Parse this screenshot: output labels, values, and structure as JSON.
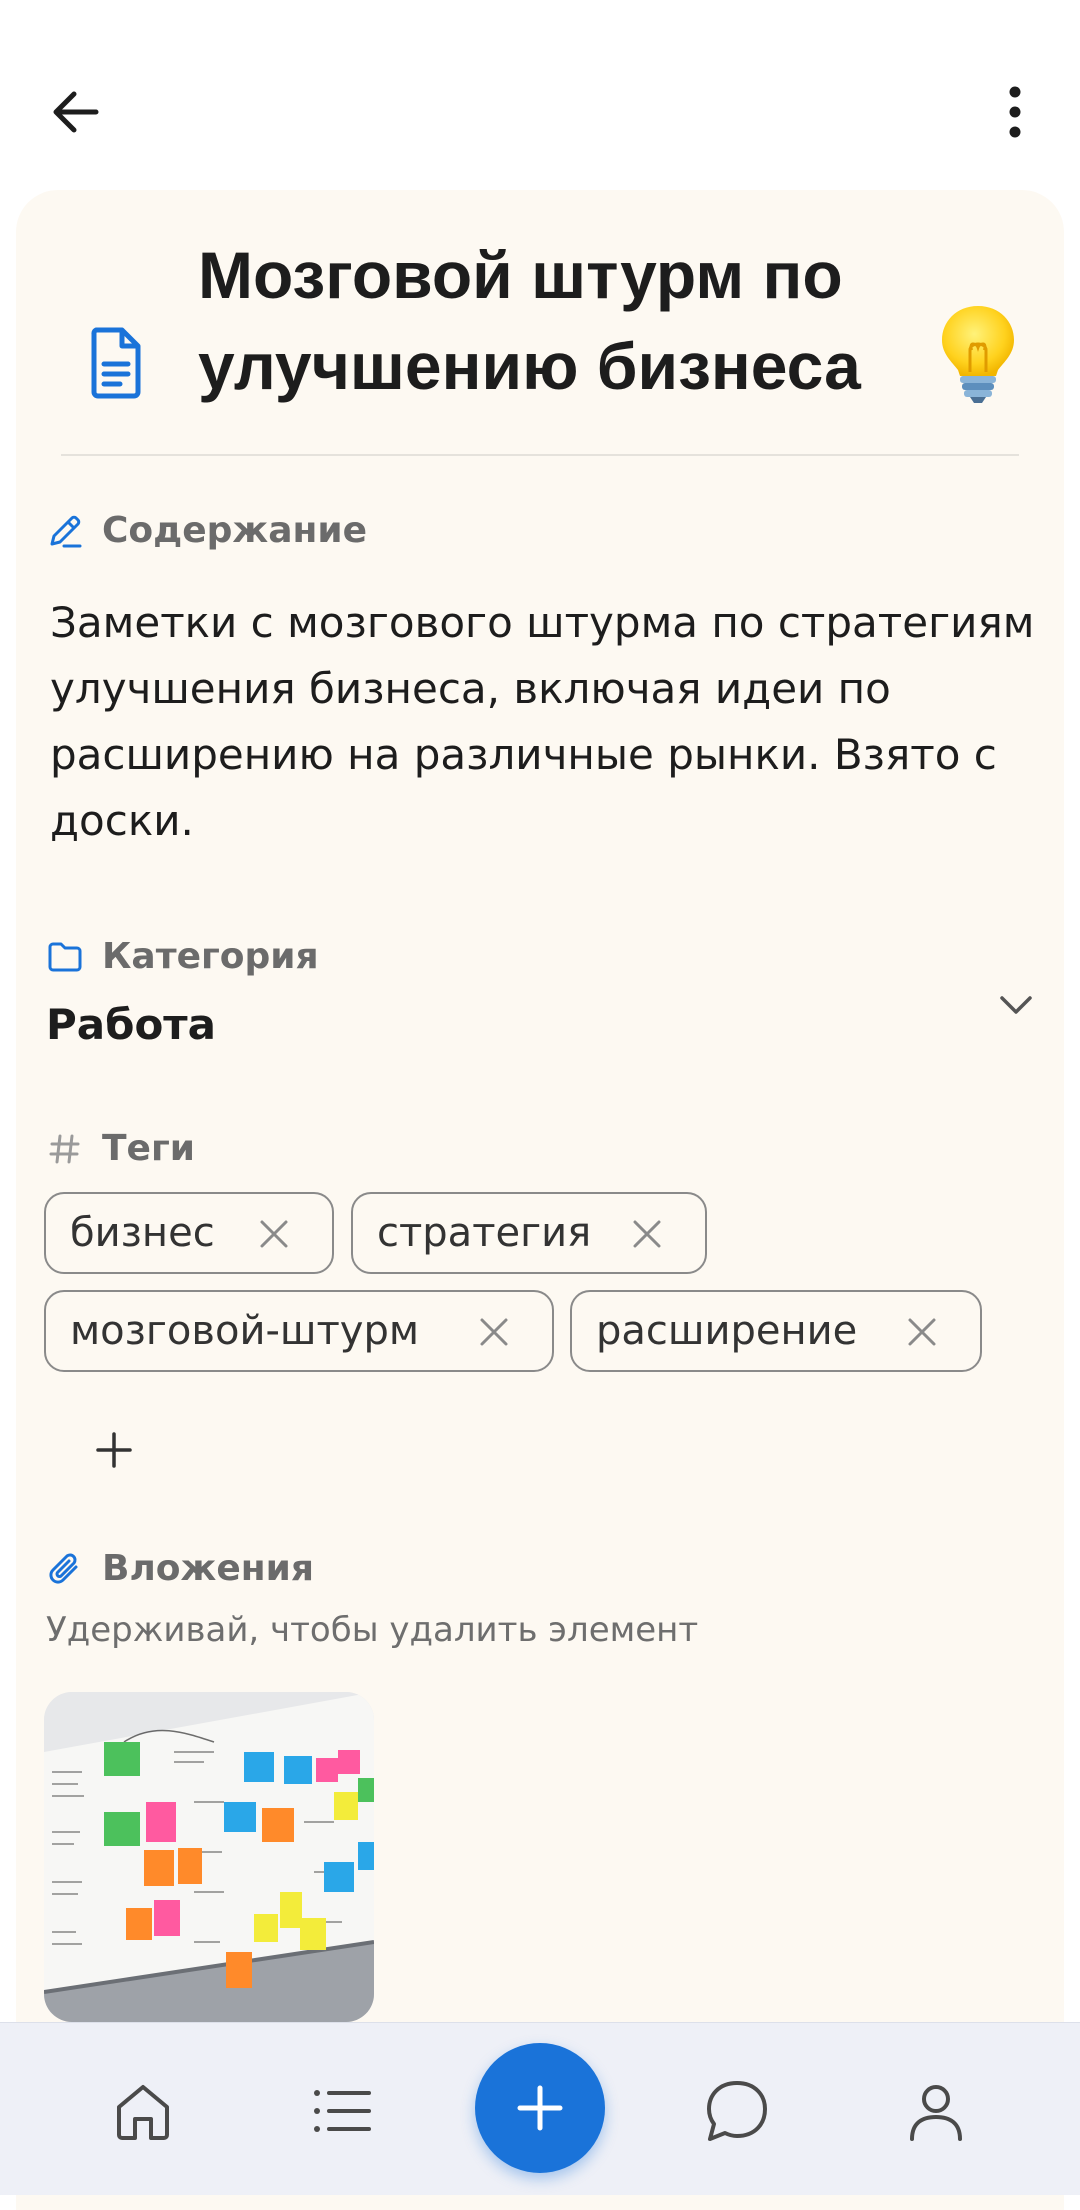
{
  "header": {
    "back_icon": "arrow-left-icon",
    "more_icon": "more-vertical-icon"
  },
  "note": {
    "title": "Мозговой штурм по улучшению бизнеса",
    "emoji_icon": "light-bulb-icon",
    "doc_icon": "document-icon"
  },
  "content": {
    "label": "Содержание",
    "text": "Заметки с мозгового штурма по стратегиям улучшения бизнеса, включая идеи по расширению на различные рынки. Взято с доски."
  },
  "category": {
    "label": "Категория",
    "value": "Работа"
  },
  "tags": {
    "label": "Теги",
    "items": [
      {
        "label": "бизнес"
      },
      {
        "label": "стратегия"
      },
      {
        "label": "мозговой-штурм"
      },
      {
        "label": "расширение"
      }
    ]
  },
  "attachments": {
    "label": "Вложения",
    "hint": "Удерживай, чтобы удалить элемент"
  },
  "bottom_nav": {
    "items": [
      "home-icon",
      "list-icon",
      "add-icon",
      "chat-icon",
      "profile-icon"
    ]
  },
  "colors": {
    "accent": "#1a73d9",
    "card_bg": "#fdf9f2",
    "nav_bg": "#eef0f7"
  }
}
